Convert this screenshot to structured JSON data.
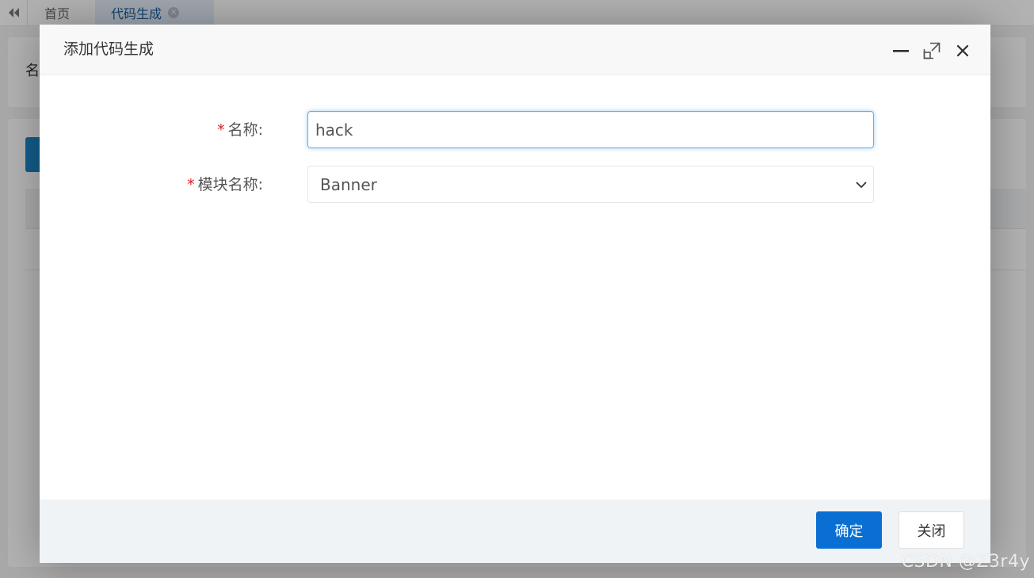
{
  "background": {
    "tabs": [
      {
        "label": "首页"
      },
      {
        "label": "代码生成"
      }
    ],
    "search_label": "名"
  },
  "dialog": {
    "title": "添加代码生成",
    "controls": {
      "minimize_icon": "minimize-icon",
      "maximize_icon": "maximize-icon",
      "close_icon": "close-icon"
    },
    "form": {
      "required_mark": "*",
      "name": {
        "label": "名称:",
        "value": "hack"
      },
      "module": {
        "label": "模块名称:",
        "selected": "Banner"
      }
    },
    "footer": {
      "confirm_label": "确定",
      "close_label": "关闭"
    }
  },
  "watermark": "CSDN @Z3r4y",
  "colors": {
    "primary": "#0a6fd3",
    "required": "#e01e1e",
    "focus_border": "#66afe9"
  }
}
